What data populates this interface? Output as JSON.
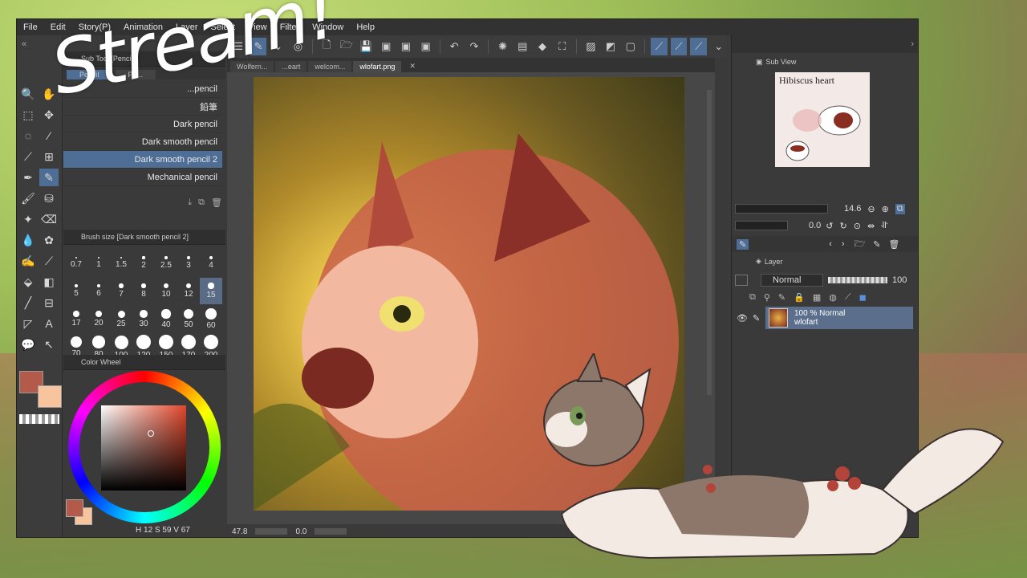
{
  "menu": [
    "File",
    "Edit",
    "Story(P)",
    "Animation",
    "Layer",
    "Select",
    "View",
    "Filter",
    "Window",
    "Help"
  ],
  "doc_tabs": [
    "Wolfern...",
    "...eart",
    "welcom...",
    "wlofart.png"
  ],
  "sub_tool": {
    "header": "Sub Tool [Pencil]",
    "tabs": [
      "Pencil",
      "Pe..."
    ],
    "brushes": [
      "...pencil",
      "鉛筆",
      "Dark pencil",
      "Dark smooth pencil",
      "Dark smooth pencil 2",
      "Mechanical pencil",
      "..."
    ],
    "selected_brush": "Dark smooth pencil 2"
  },
  "brush_size": {
    "header": "Brush size [Dark smooth pencil 2]",
    "values": [
      "0.7",
      "1",
      "1.5",
      "2",
      "2.5",
      "3",
      "4",
      "5",
      "6",
      "7",
      "8",
      "10",
      "12",
      "15",
      "17",
      "20",
      "25",
      "30",
      "40",
      "50",
      "60",
      "70",
      "80",
      "100",
      "120",
      "150",
      "170",
      "200"
    ],
    "selected": "15"
  },
  "color": {
    "header": "Color Wheel",
    "main_color": "#b45a4b",
    "sub_color": "#f7c49e",
    "hue_readout": "12",
    "sat_readout": "59",
    "val_readout": "67",
    "readout_h_label": "H",
    "readout_s_label": "S",
    "readout_v_label": "V"
  },
  "status": {
    "zoom": "47.8",
    "angle": "0.0"
  },
  "overlay_text": "Stream!",
  "sub_view": {
    "header": "Sub View",
    "thumb_title": "Hibiscus heart",
    "zoom": "14.6",
    "angle": "0.0"
  },
  "layer_panel": {
    "header": "Layer",
    "blend_mode": "Normal",
    "opacity": "100",
    "layer": {
      "line1": "100 % Normal",
      "line2": "wlofart"
    }
  }
}
